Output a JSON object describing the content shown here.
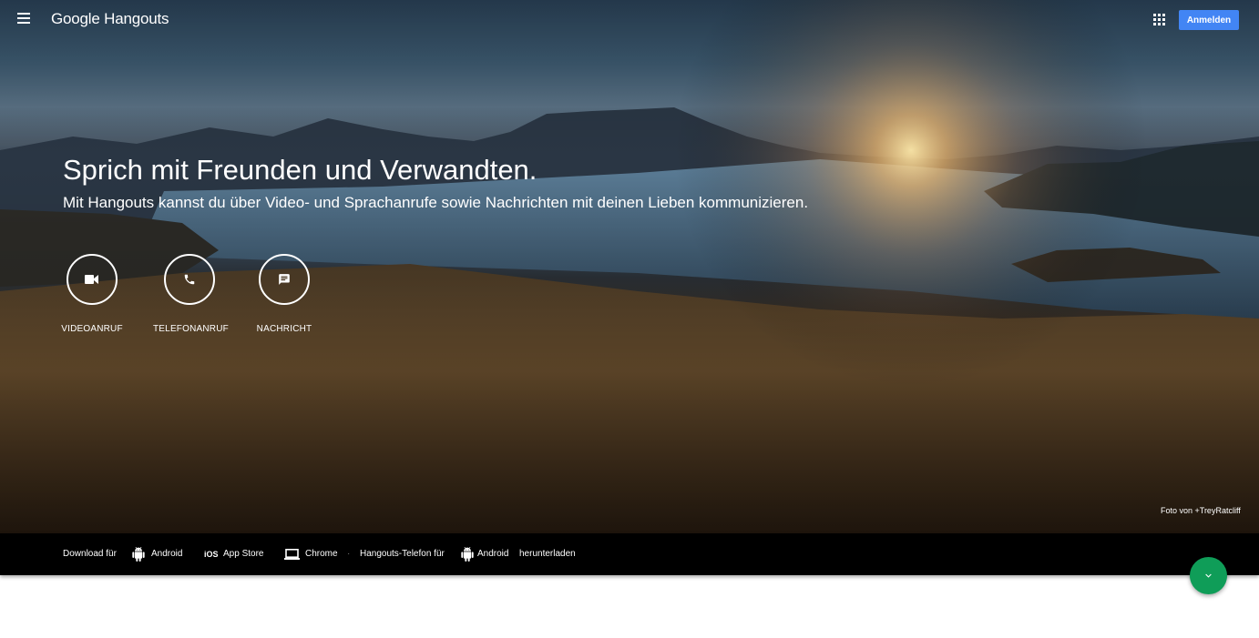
{
  "header": {
    "brand_google": "Google",
    "brand_product": "Hangouts",
    "signin_label": "Anmelden",
    "menu_icon": "hamburger-menu-icon",
    "apps_icon": "apps-grid-icon"
  },
  "hero": {
    "title": "Sprich mit Freunden und Verwandten.",
    "subtitle": "Mit Hangouts kannst du über Video- und Sprachanrufe sowie Nachrichten mit deinen Lieben kommunizieren.",
    "actions": [
      {
        "label": "VIDEOANRUF",
        "icon": "video-camera-icon"
      },
      {
        "label": "TELEFONANRUF",
        "icon": "phone-icon"
      },
      {
        "label": "NACHRICHT",
        "icon": "message-icon"
      }
    ],
    "photo_credit": "Foto von +TreyRatcliff"
  },
  "download_bar": {
    "download_for": "Download für",
    "android": "Android",
    "ios_tag": "iOS",
    "app_store": "App Store",
    "chrome": "Chrome",
    "separator": "·",
    "hangouts_phone": "Hangouts-Telefon für",
    "android2": "Android",
    "download": "herunterladen"
  },
  "colors": {
    "accent_blue": "#4285f4",
    "fab_green": "#0f9d58",
    "bar_black": "#000000"
  },
  "fab": {
    "icon": "chevron-down-icon"
  }
}
